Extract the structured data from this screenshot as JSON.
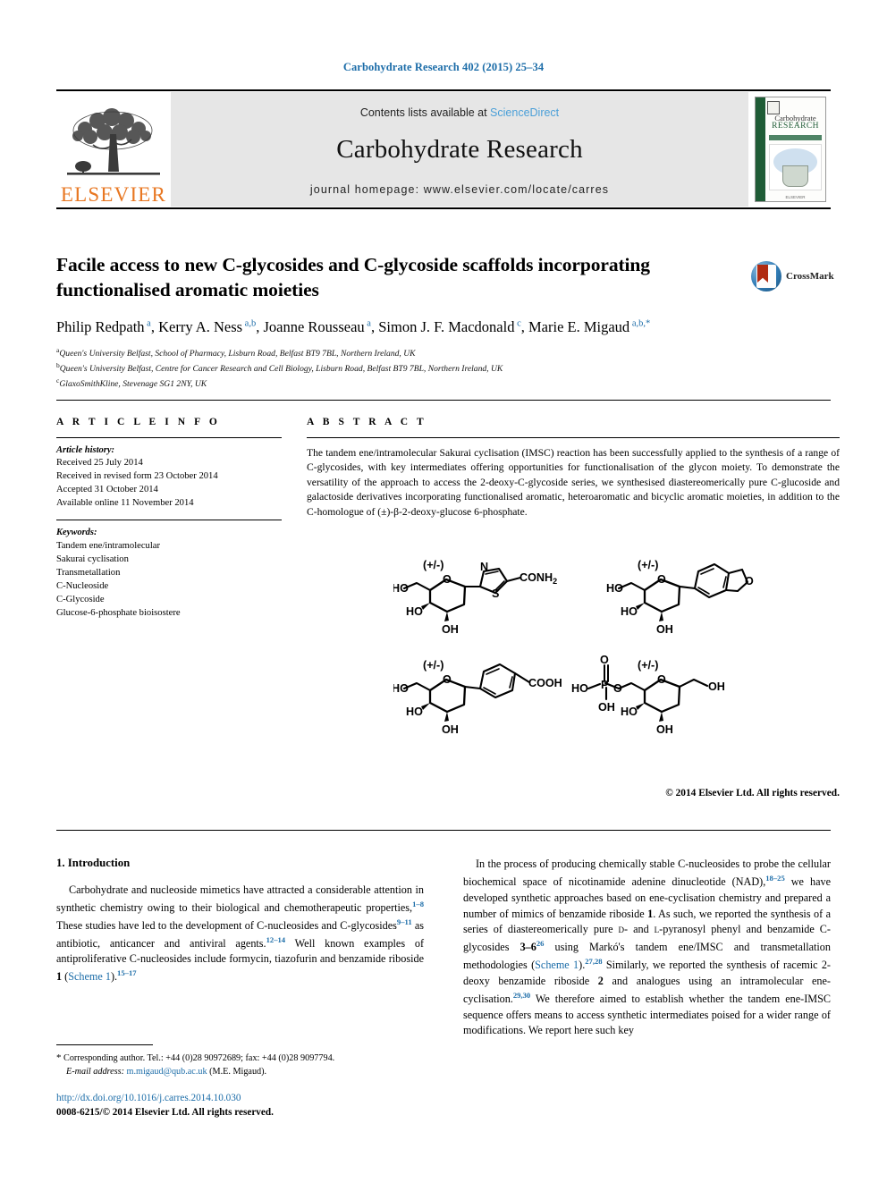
{
  "journal_ref": "Carbohydrate Research 402 (2015) 25–34",
  "masthead": {
    "publisher": "ELSEVIER",
    "contents_prefix": "Contents lists available at ",
    "contents_link": "ScienceDirect",
    "journal_name": "Carbohydrate Research",
    "homepage": "journal homepage: www.elsevier.com/locate/carres",
    "cover": {
      "line1": "Carbohydrate",
      "line2": "RESEARCH",
      "line3": "an international journal",
      "footer": "ELSEVIER"
    }
  },
  "crossmark": {
    "label": "CrossMark"
  },
  "article": {
    "title": "Facile access to new C-glycosides and C-glycoside scaffolds incorporating functionalised aromatic moieties",
    "authors": [
      {
        "name": "Philip Redpath",
        "marks": "a",
        "sep": ", "
      },
      {
        "name": "Kerry A. Ness",
        "marks": "a,b",
        "sep": ", "
      },
      {
        "name": "Joanne Rousseau",
        "marks": "a",
        "sep": ", "
      },
      {
        "name": "Simon J. F. Macdonald",
        "marks": "c",
        "sep": ", "
      },
      {
        "name": "Marie E. Migaud",
        "marks": "a,b,*",
        "sep": ""
      }
    ],
    "affiliations": [
      {
        "mark": "a",
        "text": "Queen's University Belfast, School of Pharmacy, Lisburn Road, Belfast BT9 7BL, Northern Ireland, UK"
      },
      {
        "mark": "b",
        "text": "Queen's University Belfast, Centre for Cancer Research and Cell Biology, Lisburn Road, Belfast BT9 7BL, Northern Ireland, UK"
      },
      {
        "mark": "c",
        "text": "GlaxoSmithKline, Stevenage SG1 2NY, UK"
      }
    ]
  },
  "article_info": {
    "heading": "A R T I C L E   I N F O",
    "history_label": "Article history:",
    "history": [
      "Received 25 July 2014",
      "Received in revised form 23 October 2014",
      "Accepted 31 October 2014",
      "Available online 11 November 2014"
    ],
    "keywords_label": "Keywords:",
    "keywords": [
      "Tandem ene/intramolecular",
      "Sakurai cyclisation",
      "Transmetallation",
      "C-Nucleoside",
      "C-Glycoside",
      "Glucose-6-phosphate bioisostere"
    ]
  },
  "abstract": {
    "heading": "A B S T R A C T",
    "text": "The tandem ene/intramolecular Sakurai cyclisation (IMSC) reaction has been successfully applied to the synthesis of a range of C-glycosides, with key intermediates offering opportunities for functionalisation of the glycon moiety. To demonstrate the versatility of the approach to access the 2-deoxy-C-glycoside series, we synthesised diastereomerically pure C-glucoside and galactoside derivatives incorporating functionalised aromatic, heteroaromatic and bicyclic aromatic moieties, in addition to the C-homologue of (±)-β-2-deoxy-glucose 6-phosphate.",
    "copyright": "© 2014 Elsevier Ltd. All rights reserved."
  },
  "graphical_abstract": {
    "structures": [
      {
        "id": "thiazole-carboxamide-glycoside",
        "racemic_label": "(+/-)",
        "labels": [
          "HO",
          "O",
          "HO",
          "OH",
          "N",
          "S",
          "CONH2"
        ]
      },
      {
        "id": "dihydroisobenzofuran-glycoside",
        "racemic_label": "(+/-)",
        "labels": [
          "HO",
          "O",
          "HO",
          "OH",
          "O"
        ]
      },
      {
        "id": "benzoic-acid-glycoside",
        "racemic_label": "(+/-)",
        "labels": [
          "HO",
          "O",
          "HO",
          "OH",
          "COOH"
        ]
      },
      {
        "id": "glucose-6-phosphate-homologue",
        "racemic_label": "(+/-)",
        "labels": [
          "O",
          "P",
          "HO",
          "OH",
          "O",
          "OH",
          "HO",
          "OH"
        ]
      }
    ]
  },
  "body": {
    "left": {
      "heading": "1. Introduction",
      "p1_a": "Carbohydrate and nucleoside mimetics have attracted a considerable attention in synthetic chemistry owing to their biological and chemotherapeutic properties,",
      "p1_r1": "1–8",
      "p1_b": " These studies have led to the development of C-nucleosides and C-glycosides",
      "p1_r2": "9–11",
      "p1_c": " as antibiotic, anticancer and antiviral agents.",
      "p1_r3": "12–14",
      "p1_d": " Well known examples of antiproliferative C-nucleosides include formycin, tiazofurin and benzamide riboside ",
      "p1_bold1": "1",
      "p1_e": " (",
      "p1_link1": "Scheme 1",
      "p1_f": ").",
      "p1_r4": "15–17"
    },
    "right": {
      "p1_a": "In the process of producing chemically stable C-nucleosides to probe the cellular biochemical space of nicotinamide adenine dinucleotide (NAD),",
      "p1_r1": "18–25",
      "p1_b": " we have developed synthetic approaches based on ene-cyclisation chemistry and prepared a number of mimics of benzamide riboside ",
      "p1_bold1": "1",
      "p1_c": ". As such, we reported the synthesis of a series of diastereomerically pure ",
      "p1_sc1": "d",
      "p1_d": "- and ",
      "p1_sc2": "l",
      "p1_e": "-pyranosyl phenyl and benzamide C-glycosides ",
      "p1_bold2": "3–6",
      "p1_r2": "26",
      "p1_f": " using Markó's tandem ene/IMSC and transmetallation methodologies (",
      "p1_link1": "Scheme 1",
      "p1_g": ").",
      "p1_r3": "27,28",
      "p1_h": " Similarly, we reported the synthesis of racemic 2-deoxy benzamide riboside ",
      "p1_bold3": "2",
      "p1_i": " and analogues using an intramolecular ene-cyclisation.",
      "p1_r4": "29,30",
      "p1_j": " We therefore aimed to establish whether the tandem ene-IMSC sequence offers means to access synthetic intermediates poised for a wider range of modifications. We report here such key"
    }
  },
  "footnote": {
    "star": "*",
    "text_a": "Corresponding author. Tel.: +44 (0)28 90972689; fax: +44 (0)28 9097794.",
    "email_label": "E-mail address:",
    "email": "m.migaud@qub.ac.uk",
    "email_suffix": " (M.E. Migaud)."
  },
  "footer": {
    "doi": "http://dx.doi.org/10.1016/j.carres.2014.10.030",
    "issn": "0008-6215/© 2014 Elsevier Ltd. All rights reserved."
  }
}
